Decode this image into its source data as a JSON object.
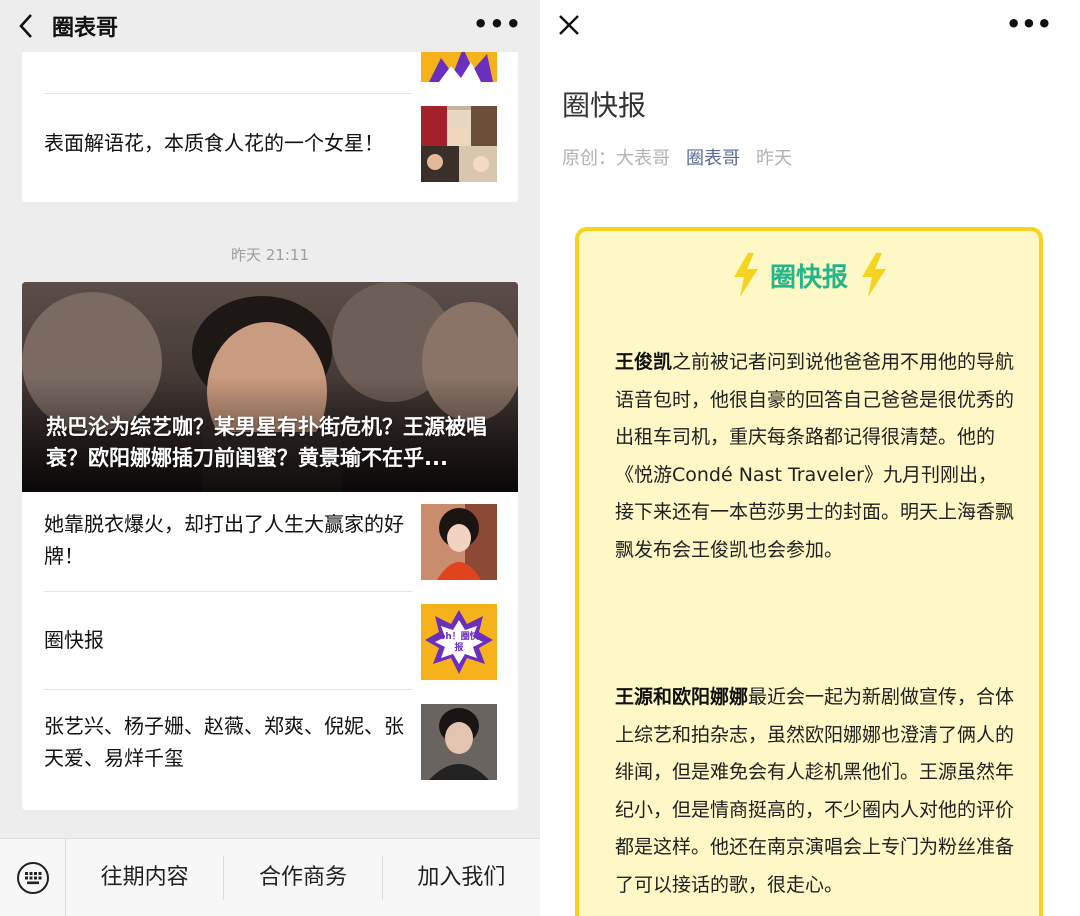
{
  "left": {
    "header": {
      "title": "圈表哥",
      "back_icon": "chevron-left-icon",
      "more_icon": "more-dots-icon"
    },
    "card1": {
      "row_title": "表面解语花，本质食人花的一个女星！"
    },
    "timestamp": "昨天 21:11",
    "card2": {
      "hero_title": "热巴沦为综艺咖？某男星有扑街危机？王源被唱衰？欧阳娜娜插刀前闺蜜？黄景瑜不在乎...",
      "rows": [
        {
          "title": "她靠脱衣爆火，却打出了人生大赢家的好牌！"
        },
        {
          "title": "圈快报",
          "thumb_text": "oh！圈快报"
        },
        {
          "title": "张艺兴、杨子姗、赵薇、郑爽、倪妮、张天爱、易烊千玺"
        }
      ]
    },
    "bottom_menu": [
      "往期内容",
      "合作商务",
      "加入我们"
    ]
  },
  "right": {
    "close_icon": "close-icon",
    "more_icon": "more-dots-icon",
    "title": "圈快报",
    "meta": {
      "origin": "原创：大表哥",
      "account": "圈表哥",
      "date": "昨天"
    },
    "box_title": "圈快报",
    "paragraphs": [
      {
        "bold": "王俊凯",
        "text": "之前被记者问到说他爸爸用不用他的导航语音包时，他很自豪的回答自己爸爸是很优秀的出租车司机，重庆每条路都记得很清楚。他的《悦游Condé Nast Traveler》九月刊刚出，接下来还有一本芭莎男士的封面。明天上海香飘飘发布会王俊凯也会参加。"
      },
      {
        "bold": "王源和欧阳娜娜",
        "text": "最近会一起为新剧做宣传，合体上综艺和拍杂志，虽然欧阳娜娜也澄清了俩人的绯闻，但是难免会有人趁机黑他们。王源虽然年纪小，但是情商挺高的，不少圈内人对他的评价都是这样。他还在南京演唱会上专门为粉丝准备了可以接话的歌，很走心。"
      }
    ],
    "colors": {
      "box_bg": "#fdf8c6",
      "box_border": "#f6d31f",
      "title_green": "#24b58a",
      "bolt": "#f6d31f",
      "link_blue": "#576b95"
    }
  }
}
